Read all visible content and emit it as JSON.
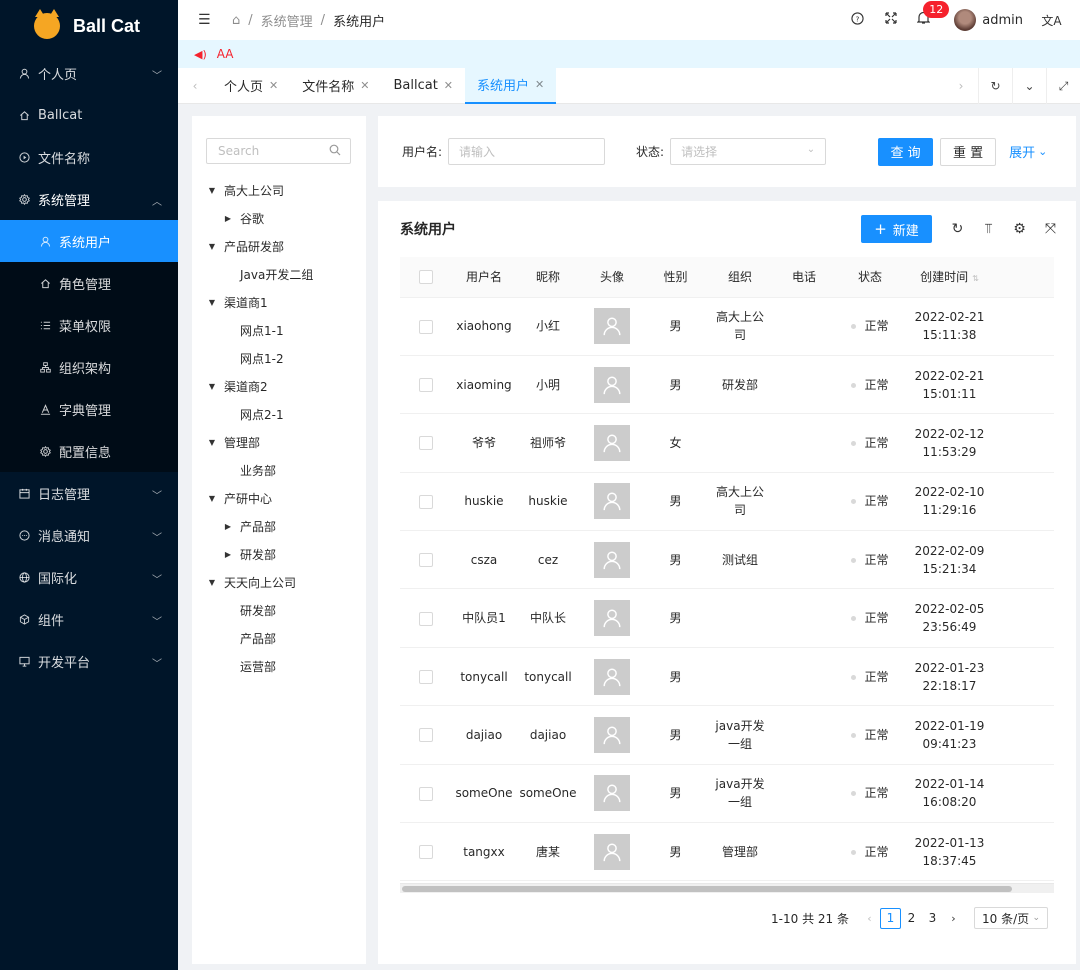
{
  "app": {
    "name": "Ball Cat"
  },
  "sidebar": {
    "items": [
      {
        "label": "个人页",
        "icon": "user-icon",
        "arrow": "down"
      },
      {
        "label": "Ballcat",
        "icon": "home-icon"
      },
      {
        "label": "文件名称",
        "icon": "play-circle-icon"
      },
      {
        "label": "系统管理",
        "icon": "setting-icon",
        "arrow": "up",
        "children": [
          {
            "label": "系统用户",
            "icon": "user-icon",
            "selected": true
          },
          {
            "label": "角色管理",
            "icon": "home-icon"
          },
          {
            "label": "菜单权限",
            "icon": "menu-icon"
          },
          {
            "label": "组织架构",
            "icon": "cluster-icon"
          },
          {
            "label": "字典管理",
            "icon": "font-icon"
          },
          {
            "label": "配置信息",
            "icon": "setting-icon"
          }
        ]
      },
      {
        "label": "日志管理",
        "icon": "calendar-icon",
        "arrow": "down"
      },
      {
        "label": "消息通知",
        "icon": "message-icon",
        "arrow": "down"
      },
      {
        "label": "国际化",
        "icon": "global-icon",
        "arrow": "down"
      },
      {
        "label": "组件",
        "icon": "code-sandbox-icon",
        "arrow": "down"
      },
      {
        "label": "开发平台",
        "icon": "desktop-icon",
        "arrow": "down"
      }
    ]
  },
  "header": {
    "breadcrumb": [
      "系统管理",
      "系统用户"
    ],
    "notification_count": "12",
    "username": "admin"
  },
  "notice": {
    "text": "AA"
  },
  "tabs": [
    {
      "label": "个人页",
      "active": false
    },
    {
      "label": "文件名称",
      "active": false
    },
    {
      "label": "Ballcat",
      "active": false
    },
    {
      "label": "系统用户",
      "active": true
    }
  ],
  "tree": {
    "search_placeholder": "Search",
    "nodes": [
      {
        "label": "高大上公司",
        "level": 1,
        "switcher": "expanded"
      },
      {
        "label": "谷歌",
        "level": 2,
        "switcher": "collapsed"
      },
      {
        "label": "产品研发部",
        "level": 1,
        "switcher": "expanded"
      },
      {
        "label": "Java开发二组",
        "level": 2,
        "switcher": "none"
      },
      {
        "label": "渠道商1",
        "level": 1,
        "switcher": "expanded"
      },
      {
        "label": "网点1-1",
        "level": 2,
        "switcher": "none"
      },
      {
        "label": "网点1-2",
        "level": 2,
        "switcher": "none"
      },
      {
        "label": "渠道商2",
        "level": 1,
        "switcher": "expanded"
      },
      {
        "label": "网点2-1",
        "level": 2,
        "switcher": "none"
      },
      {
        "label": "管理部",
        "level": 1,
        "switcher": "expanded"
      },
      {
        "label": "业务部",
        "level": 2,
        "switcher": "none"
      },
      {
        "label": "产研中心",
        "level": 1,
        "switcher": "expanded"
      },
      {
        "label": "产品部",
        "level": 2,
        "switcher": "collapsed"
      },
      {
        "label": "研发部",
        "level": 2,
        "switcher": "collapsed"
      },
      {
        "label": "天天向上公司",
        "level": 1,
        "switcher": "expanded"
      },
      {
        "label": "研发部",
        "level": 2,
        "switcher": "none"
      },
      {
        "label": "产品部",
        "level": 2,
        "switcher": "none"
      },
      {
        "label": "运营部",
        "level": 2,
        "switcher": "none"
      }
    ]
  },
  "search_form": {
    "username_label": "用户名:",
    "username_placeholder": "请输入",
    "status_label": "状态:",
    "status_placeholder": "请选择",
    "query_label": "查 询",
    "reset_label": "重 置",
    "expand_label": "展开"
  },
  "table": {
    "title": "系统用户",
    "new_label": "新建",
    "columns": [
      "用户名",
      "昵称",
      "头像",
      "性别",
      "组织",
      "电话",
      "状态",
      "创建时间"
    ],
    "rows": [
      {
        "username": "xiaohong",
        "nickname": "小红",
        "gender": "男",
        "org": "高大上公司",
        "phone": "",
        "status": "正常",
        "created": "2022-02-21 15:11:38"
      },
      {
        "username": "xiaoming",
        "nickname": "小明",
        "gender": "男",
        "org": "研发部",
        "phone": "",
        "status": "正常",
        "created": "2022-02-21 15:01:11"
      },
      {
        "username": "爷爷",
        "nickname": "祖师爷",
        "gender": "女",
        "org": "",
        "phone": "",
        "status": "正常",
        "created": "2022-02-12 11:53:29"
      },
      {
        "username": "huskie",
        "nickname": "huskie",
        "gender": "男",
        "org": "高大上公司",
        "phone": "",
        "status": "正常",
        "created": "2022-02-10 11:29:16"
      },
      {
        "username": "csza",
        "nickname": "cez",
        "gender": "男",
        "org": "测试组",
        "phone": "",
        "status": "正常",
        "created": "2022-02-09 15:21:34"
      },
      {
        "username": "中队员1",
        "nickname": "中队长",
        "gender": "男",
        "org": "",
        "phone": "",
        "status": "正常",
        "created": "2022-02-05 23:56:49"
      },
      {
        "username": "tonycall",
        "nickname": "tonycall",
        "gender": "男",
        "org": "",
        "phone": "",
        "status": "正常",
        "created": "2022-01-23 22:18:17"
      },
      {
        "username": "dajiao",
        "nickname": "dajiao",
        "gender": "男",
        "org": "java开发一组",
        "phone": "",
        "status": "正常",
        "created": "2022-01-19 09:41:23"
      },
      {
        "username": "someOne",
        "nickname": "someOne",
        "gender": "男",
        "org": "java开发一组",
        "phone": "",
        "status": "正常",
        "created": "2022-01-14 16:08:20"
      },
      {
        "username": "tangxx",
        "nickname": "唐某",
        "gender": "男",
        "org": "管理部",
        "phone": "",
        "status": "正常",
        "created": "2022-01-13 18:37:45"
      }
    ]
  },
  "pagination": {
    "total_text": "1-10 共 21 条",
    "pages": [
      "1",
      "2",
      "3"
    ],
    "current": "1",
    "page_size": "10 条/页"
  },
  "colors": {
    "primary": "#1890ff",
    "sider": "#001529",
    "danger": "#f5222d"
  }
}
